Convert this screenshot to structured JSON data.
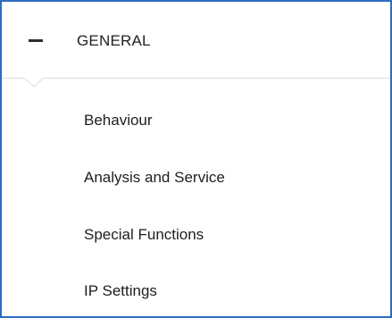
{
  "section": {
    "title": "GENERAL",
    "expanded": true,
    "toggle_icon": "collapse-minus-icon"
  },
  "menu": {
    "items": [
      {
        "label": "Behaviour"
      },
      {
        "label": "Analysis and Service"
      },
      {
        "label": "Special Functions"
      },
      {
        "label": "IP Settings"
      }
    ]
  },
  "colors": {
    "frame_border": "#2f6cc0",
    "divider": "#dcdcdc",
    "text": "#1e1e1e"
  }
}
